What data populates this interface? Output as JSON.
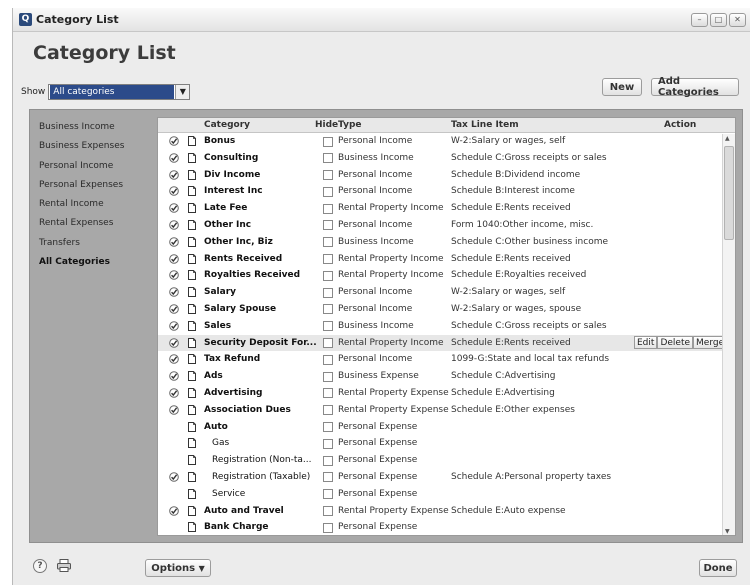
{
  "window": {
    "title": "Category List"
  },
  "page": {
    "title": "Category List"
  },
  "show": {
    "label": "Show",
    "selected": "All categories"
  },
  "buttons": {
    "new": "New",
    "add_categories": "Add Categories",
    "options": "Options",
    "done": "Done"
  },
  "sidebar": {
    "items": [
      {
        "label": "Business Income",
        "active": false
      },
      {
        "label": "Business Expenses",
        "active": false
      },
      {
        "label": "Personal Income",
        "active": false
      },
      {
        "label": "Personal Expenses",
        "active": false
      },
      {
        "label": "Rental Income",
        "active": false
      },
      {
        "label": "Rental Expenses",
        "active": false
      },
      {
        "label": "Transfers",
        "active": false
      },
      {
        "label": "All Categories",
        "active": true
      }
    ]
  },
  "table": {
    "headers": {
      "category": "Category",
      "hide": "Hide",
      "type": "Type",
      "tax_line": "Tax Line Item",
      "action": "Action"
    },
    "rows": [
      {
        "check": true,
        "category": "Bonus",
        "sub": false,
        "type": "Personal Income",
        "tax_line": "W-2:Salary or wages, self"
      },
      {
        "check": true,
        "category": "Consulting",
        "sub": false,
        "type": "Business Income",
        "tax_line": "Schedule C:Gross receipts or sales"
      },
      {
        "check": true,
        "category": "Div Income",
        "sub": false,
        "type": "Personal Income",
        "tax_line": "Schedule B:Dividend income"
      },
      {
        "check": true,
        "category": "Interest Inc",
        "sub": false,
        "type": "Personal Income",
        "tax_line": "Schedule B:Interest income"
      },
      {
        "check": true,
        "category": "Late Fee",
        "sub": false,
        "type": "Rental Property Income",
        "tax_line": "Schedule E:Rents received"
      },
      {
        "check": true,
        "category": "Other Inc",
        "sub": false,
        "type": "Personal Income",
        "tax_line": "Form 1040:Other income, misc."
      },
      {
        "check": true,
        "category": "Other Inc, Biz",
        "sub": false,
        "type": "Business Income",
        "tax_line": "Schedule C:Other business income"
      },
      {
        "check": true,
        "category": "Rents Received",
        "sub": false,
        "type": "Rental Property Income",
        "tax_line": "Schedule E:Rents received"
      },
      {
        "check": true,
        "category": "Royalties Received",
        "sub": false,
        "type": "Rental Property Income",
        "tax_line": "Schedule E:Royalties received"
      },
      {
        "check": true,
        "category": "Salary",
        "sub": false,
        "type": "Personal Income",
        "tax_line": "W-2:Salary or wages, self"
      },
      {
        "check": true,
        "category": "Salary Spouse",
        "sub": false,
        "type": "Personal Income",
        "tax_line": "W-2:Salary or wages, spouse"
      },
      {
        "check": true,
        "category": "Sales",
        "sub": false,
        "type": "Business Income",
        "tax_line": "Schedule C:Gross receipts or sales"
      },
      {
        "check": true,
        "category": "Security Deposit For...",
        "sub": false,
        "type": "Rental Property Income",
        "tax_line": "Schedule E:Rents received",
        "selected": true
      },
      {
        "check": true,
        "category": "Tax Refund",
        "sub": false,
        "type": "Personal Income",
        "tax_line": "1099-G:State and local tax refunds"
      },
      {
        "check": true,
        "category": "Ads",
        "sub": false,
        "type": "Business Expense",
        "tax_line": "Schedule C:Advertising"
      },
      {
        "check": true,
        "category": "Advertising",
        "sub": false,
        "type": "Rental Property Expense",
        "tax_line": "Schedule E:Advertising"
      },
      {
        "check": true,
        "category": "Association Dues",
        "sub": false,
        "type": "Rental Property Expense",
        "tax_line": "Schedule E:Other expenses"
      },
      {
        "check": false,
        "category": "Auto",
        "sub": false,
        "type": "Personal Expense",
        "tax_line": ""
      },
      {
        "check": false,
        "category": "Gas",
        "sub": true,
        "type": "Personal Expense",
        "tax_line": ""
      },
      {
        "check": false,
        "category": "Registration (Non-ta...",
        "sub": true,
        "type": "Personal Expense",
        "tax_line": ""
      },
      {
        "check": true,
        "category": "Registration (Taxable)",
        "sub": true,
        "type": "Personal Expense",
        "tax_line": "Schedule A:Personal property taxes"
      },
      {
        "check": false,
        "category": "Service",
        "sub": true,
        "type": "Personal Expense",
        "tax_line": ""
      },
      {
        "check": true,
        "category": "Auto and Travel",
        "sub": false,
        "type": "Rental Property Expense",
        "tax_line": "Schedule E:Auto expense"
      },
      {
        "check": false,
        "category": "Bank Charge",
        "sub": false,
        "type": "Personal Expense",
        "tax_line": ""
      }
    ],
    "row_actions": {
      "edit": "Edit",
      "delete": "Delete",
      "merge": "Merge"
    }
  },
  "icons": {
    "check": "checkmark-circle-icon",
    "doc": "document-icon",
    "help": "help-icon",
    "print": "printer-icon"
  }
}
